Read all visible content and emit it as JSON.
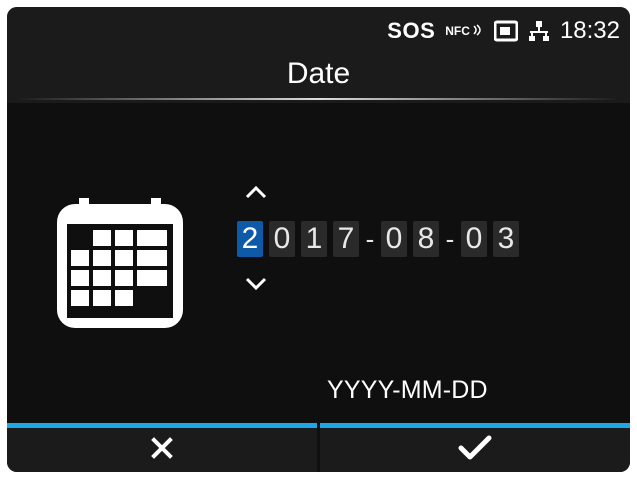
{
  "statusbar": {
    "sos": "SOS",
    "nfc": "NFC",
    "time": "18:32",
    "icons": [
      "nfc-icon",
      "memory-card-icon",
      "network-icon"
    ]
  },
  "title": "Date",
  "date_editor": {
    "digits": [
      "2",
      "0",
      "1",
      "7",
      "-",
      "0",
      "8",
      "-",
      "0",
      "3"
    ],
    "selected_index": 0,
    "format": "YYYY-MM-DD"
  },
  "footer": {
    "cancel_icon": "close-icon",
    "confirm_icon": "check-icon"
  },
  "colors": {
    "background": "#1b1b1b",
    "content": "#0f0f0f",
    "accent": "#1ea7e6",
    "selected_digit": "#0d5aa8",
    "digit_cell": "#2a2a2a",
    "text": "#ffffff"
  }
}
